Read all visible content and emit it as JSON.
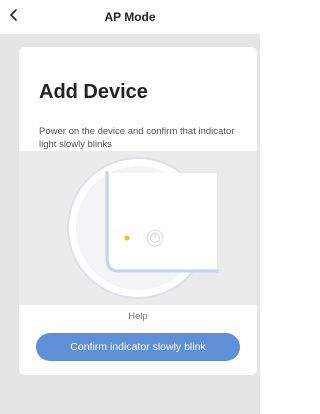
{
  "nav": {
    "back_icon": "chevron-left-icon",
    "title": "AP Mode"
  },
  "card": {
    "title": "Add Device",
    "description": "Power on the device and confirm that indicator light slowly blinks"
  },
  "illustration": {
    "indicator_color": "#f5c518",
    "power_icon": "power-icon"
  },
  "help_label": "Help",
  "confirm_button_label": "Confirm indicator slowly blink",
  "colors": {
    "accent": "#5f8fd6",
    "background": "#e5e5e5",
    "card": "#ffffff"
  }
}
